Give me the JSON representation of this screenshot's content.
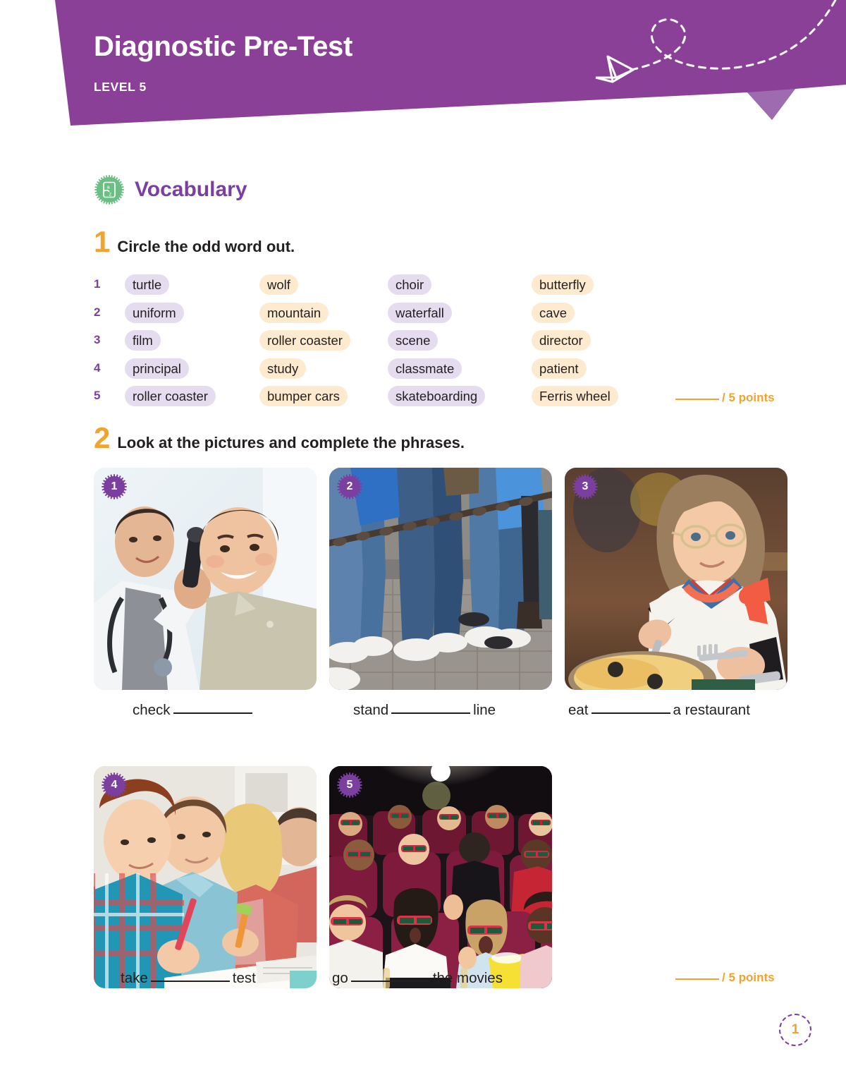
{
  "header": {
    "title": "Diagnostic Pre-Test",
    "level": "LEVEL 5",
    "band_color": "#8b4098",
    "fold_color": "#9f6bb0",
    "airplane_icon": "paper-airplane-icon",
    "flight_path_icon": "dashed-loop-path-icon"
  },
  "section": {
    "title": "Vocabulary",
    "badge_icon": "vocabulary-dictionary-badge-icon",
    "badge_color": "#6cbf84",
    "title_color": "#7b3fa0"
  },
  "exercise1": {
    "number": "1",
    "instruction": "Circle the odd word out.",
    "rows": [
      {
        "num": "1",
        "words": [
          "turtle",
          "wolf",
          "choir",
          "butterfly"
        ]
      },
      {
        "num": "2",
        "words": [
          "uniform",
          "mountain",
          "waterfall",
          "cave"
        ]
      },
      {
        "num": "3",
        "words": [
          "film",
          "roller coaster",
          "scene",
          "director"
        ]
      },
      {
        "num": "4",
        "words": [
          "principal",
          "study",
          "classmate",
          "patient"
        ]
      },
      {
        "num": "5",
        "words": [
          "roller coaster",
          "bumper cars",
          "skateboarding",
          "Ferris wheel"
        ]
      }
    ],
    "points_label": "/ 5 points"
  },
  "exercise2": {
    "number": "2",
    "instruction": "Look at the pictures and complete the phrases.",
    "pictures": [
      {
        "badge": "1",
        "alt": "doctor examining a boy's ear with an otoscope"
      },
      {
        "badge": "2",
        "alt": "people standing in a queue behind a chain barrier"
      },
      {
        "badge": "3",
        "alt": "girl with glasses eating pizza at a restaurant"
      },
      {
        "badge": "4",
        "alt": "students writing a test in a classroom"
      },
      {
        "badge": "5",
        "alt": "audience wearing 3D glasses in a cinema"
      }
    ],
    "captions": [
      {
        "before": "check",
        "after": ""
      },
      {
        "before": "stand",
        "after": "line"
      },
      {
        "before": "eat",
        "after": "a restaurant"
      },
      {
        "before": "take",
        "after": "test"
      },
      {
        "before": "go",
        "after": "the movies"
      }
    ],
    "points_label": "/ 5 points"
  },
  "footer": {
    "page_number": "1"
  }
}
